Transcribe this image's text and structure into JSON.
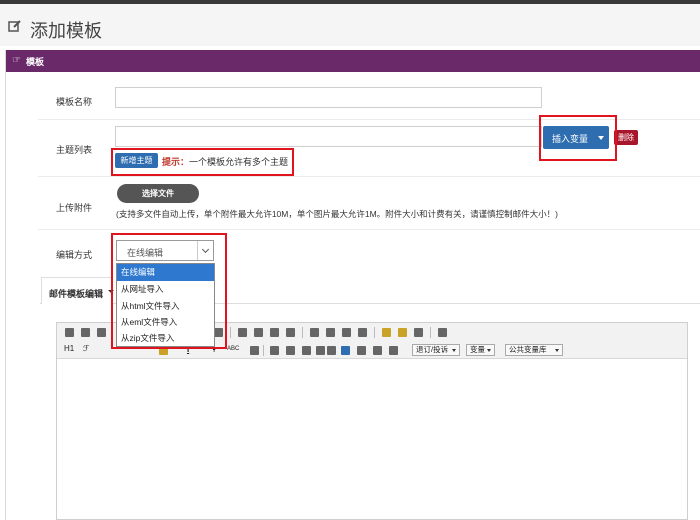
{
  "page": {
    "title": "添加模板"
  },
  "panel": {
    "title": "模板"
  },
  "form": {
    "template_name_label": "模板名称",
    "topic_list_label": "主题列表",
    "insert_variable_label": "插入变量",
    "delete_label": "删除",
    "add_topic_label": "新增主题",
    "hint_prefix": "提示：",
    "hint_text": "一个模板允许有多个主题",
    "upload_label": "上传附件",
    "choose_file_label": "选择文件",
    "upload_note": "(支持多文件自动上传，单个附件最大允许10M，单个图片最大允许1M。附件大小和计费有关，请谨慎控制邮件大小！)",
    "edit_mode_label": "编辑方式",
    "edit_mode_selected": "在线编辑",
    "edit_mode_options": [
      "在线编辑",
      "从网址导入",
      "从html文件导入",
      "从eml文件导入",
      "从zip文件导入"
    ]
  },
  "tab": {
    "label": "邮件模板编辑"
  },
  "toolbar": {
    "h1": "H1",
    "font": "ℱ",
    "abc": "ABC",
    "subscribe": "退订/投诉",
    "variable": "变量",
    "public_vars": "公共变量库"
  },
  "colors": {
    "accent": "#2d6db0",
    "header": "#6a2a6a",
    "danger": "#a8162b",
    "highlight": "#e0141e"
  }
}
